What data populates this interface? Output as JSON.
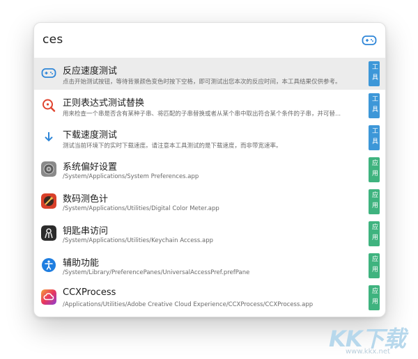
{
  "search": {
    "query": "ces"
  },
  "results": [
    {
      "title": "反应速度测试",
      "subtitle": "点击开始测试按钮，等待背景颜色变色时按下空格，即可测试出您本次的反应时间，本工具结果仅供参考。",
      "badge": "工具",
      "icon": "gamepad-icon",
      "selected": true
    },
    {
      "title": "正则表达式测试替换",
      "subtitle": "用来检查一个串是否含有某种子串、将匹配的子串替换或者从某个串中取出符合某个条件的子串，并可替...",
      "badge": "工具",
      "icon": "regex-search-icon",
      "selected": false
    },
    {
      "title": "下载速度测试",
      "subtitle": "测试当前环境下的实时下载速度。请注意本工具测试的是下载速度，而非带宽速率。",
      "badge": "工具",
      "icon": "download-arrow-icon",
      "selected": false
    },
    {
      "title": "系统偏好设置",
      "subtitle": "/System/Applications/System Preferences.app",
      "badge": "应用",
      "icon": "system-preferences-icon",
      "selected": false
    },
    {
      "title": "数码测色计",
      "subtitle": "/System/Applications/Utilities/Digital Color Meter.app",
      "badge": "应用",
      "icon": "color-meter-icon",
      "selected": false
    },
    {
      "title": "钥匙串访问",
      "subtitle": "/System/Applications/Utilities/Keychain Access.app",
      "badge": "应用",
      "icon": "keychain-icon",
      "selected": false
    },
    {
      "title": "辅助功能",
      "subtitle": "/System/Library/PreferencePanes/UniversalAccessPref.prefPane",
      "badge": "应用",
      "icon": "accessibility-icon",
      "selected": false
    },
    {
      "title": "CCXProcess",
      "subtitle": "/Applications/Utilities/Adobe Creative Cloud Experience/CCXProcess/CCXProcess.app",
      "badge": "应用",
      "icon": "creative-cloud-icon",
      "selected": false
    }
  ],
  "watermark": {
    "logo": "KK下载",
    "url": "www.kkx.net"
  },
  "colors": {
    "tool_badge": "#3d97d8",
    "app_badge": "#3fb37f",
    "selected_row": "#ececec",
    "accent_blue": "#2f86d8"
  }
}
